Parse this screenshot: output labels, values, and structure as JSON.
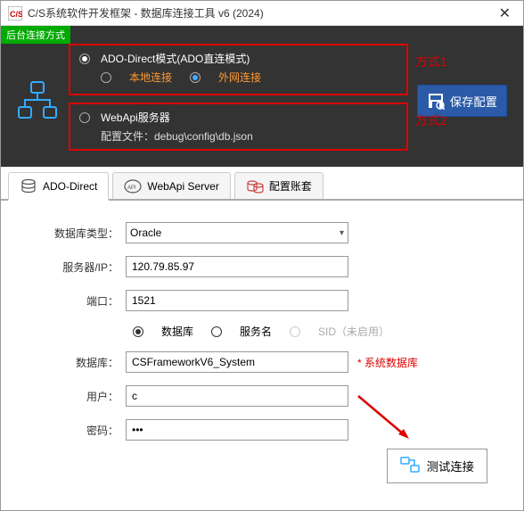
{
  "titlebar": {
    "title": "C/S系统软件开发框架 - 数据库连接工具 v6 (2024)"
  },
  "top": {
    "mode_tag": "后台连接方式",
    "option1": {
      "label": "ADO-Direct模式(ADO直连模式)",
      "sub_local": "本地连接",
      "sub_external": "外网连接",
      "anno": "方式1"
    },
    "option2": {
      "label": "WebApi服务器",
      "config_line": "配置文件：debug\\config\\db.json",
      "anno": "方式2"
    },
    "save_btn": "保存配置"
  },
  "tabs": {
    "t1": "ADO-Direct",
    "t2": "WebApi Server",
    "t3": "配置账套"
  },
  "form": {
    "db_type_label": "数据库类型：",
    "db_type_value": "Oracle",
    "server_label": "服务器/IP：",
    "server_value": "120.79.85.97",
    "port_label": "端口：",
    "port_value": "1521",
    "radio_db": "数据库",
    "radio_svc": "服务名",
    "radio_sid": "SID（未启用）",
    "dbname_label": "数据库：",
    "dbname_value": "CSFrameworkV6_System",
    "dbname_note": "* 系统数据库",
    "user_label": "用户：",
    "user_value": "c",
    "pwd_label": "密码：",
    "pwd_value": "***",
    "test_btn": "测试连接"
  }
}
